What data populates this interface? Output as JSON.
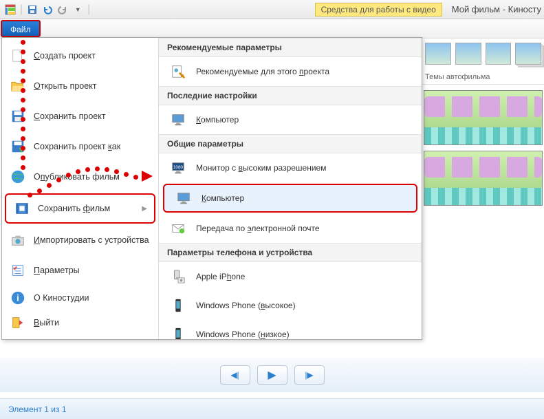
{
  "titlebar": {
    "video_tools": "Средства для работы с видео",
    "app_title": "Мой фильм - Киносту"
  },
  "tabs": {
    "file": "Файл"
  },
  "file_menu": {
    "items": [
      {
        "label": "Создать проект",
        "u": "С"
      },
      {
        "label": "Открыть проект",
        "u": "О"
      },
      {
        "label": "Сохранить проект",
        "u": "С"
      },
      {
        "label": "Сохранить проект как",
        "u": "к"
      },
      {
        "label": "Опубликовать фильм",
        "u": "п"
      },
      {
        "label": "Сохранить фильм",
        "u": "ф"
      },
      {
        "label": "Импортировать с устройства",
        "u": "И"
      },
      {
        "label": "Параметры",
        "u": "П"
      },
      {
        "label": "О Киностудии"
      },
      {
        "label": "Выйти",
        "u": "В"
      }
    ]
  },
  "submenu": {
    "sections": {
      "recommended": "Рекомендуемые параметры",
      "recent": "Последние настройки",
      "common": "Общие параметры",
      "phone": "Параметры телефона и устройства"
    },
    "items": {
      "rec_project": {
        "pre": "Рекомендуемые для этого ",
        "u": "п",
        "post": "роекта"
      },
      "computer1": {
        "u": "К",
        "post": "омпьютер"
      },
      "hd_monitor": {
        "pre": "Монитор с ",
        "u": "в",
        "post": "ысоким разрешением"
      },
      "computer2": {
        "u": "К",
        "post": "омпьютер"
      },
      "email": {
        "pre": "Передача по ",
        "u": "э",
        "post": "лектронной почте"
      },
      "iphone": {
        "pre": "Apple iP",
        "u": "h",
        "post": "one"
      },
      "wp_high": {
        "pre": "Windows Phone (",
        "u": "в",
        "post": "ысокое)"
      },
      "wp_low": {
        "pre": "Windows Phone (",
        "u": "н",
        "post": "изкое)"
      }
    }
  },
  "content": {
    "themes_label": "Темы автофильма"
  },
  "status": {
    "text": "Элемент 1 из 1"
  }
}
